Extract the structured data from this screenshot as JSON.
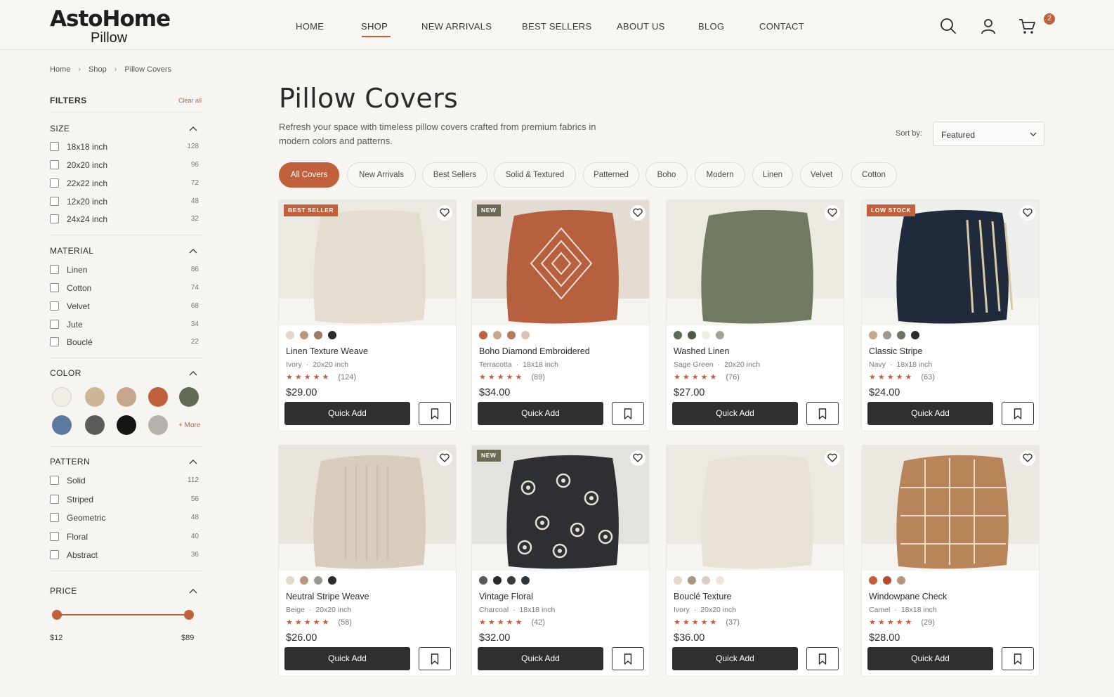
{
  "brand": {
    "name": "AstoHome",
    "sub": "Pillow"
  },
  "nav": [
    "HOME",
    "SHOP",
    "NEW ARRIVALS",
    "BEST SELLERS",
    "ABOUT US",
    "BLOG",
    "CONTACT"
  ],
  "cart": {
    "count": "2"
  },
  "breadcrumb": [
    "Home",
    "Shop",
    "Pillow Covers"
  ],
  "filters": {
    "title": "FILTERS",
    "clear": "Clear all",
    "size": {
      "title": "SIZE",
      "options": [
        {
          "label": "18x18 inch",
          "count": "128"
        },
        {
          "label": "20x20 inch",
          "count": "96"
        },
        {
          "label": "22x22 inch",
          "count": "72"
        },
        {
          "label": "12x20 inch",
          "count": "48"
        },
        {
          "label": "24x24 inch",
          "count": "32"
        }
      ]
    },
    "material": {
      "title": "MATERIAL",
      "options": [
        {
          "label": "Linen",
          "count": "86"
        },
        {
          "label": "Cotton",
          "count": "74"
        },
        {
          "label": "Velvet",
          "count": "68"
        },
        {
          "label": "Jute",
          "count": "34"
        },
        {
          "label": "Bouclé",
          "count": "22"
        }
      ]
    },
    "color": {
      "title": "COLOR",
      "swatches": [
        "#f1eee8",
        "#cdb597",
        "#c8a68e",
        "#c0603d",
        "#5f6b55",
        "#5b7a9e",
        "#5b5b5b",
        "#161616",
        "#b6b1ab"
      ],
      "more": "+ More"
    },
    "pattern": {
      "title": "PATTERN",
      "options": [
        {
          "label": "Solid",
          "count": "112"
        },
        {
          "label": "Striped",
          "count": "56"
        },
        {
          "label": "Geometric",
          "count": "48"
        },
        {
          "label": "Floral",
          "count": "40"
        },
        {
          "label": "Abstract",
          "count": "36"
        }
      ]
    },
    "price": {
      "title": "PRICE",
      "min": "$12",
      "max": "$89"
    }
  },
  "page": {
    "title": "Pillow Covers",
    "description": "Refresh your space with timeless pillow covers crafted from premium fabrics in modern colors and patterns.",
    "sort_label": "Sort by:",
    "sort_value": "Featured"
  },
  "categories": [
    "All Covers",
    "New Arrivals",
    "Best Sellers",
    "Solid & Textured",
    "Patterned",
    "Boho",
    "Modern",
    "Linen",
    "Velvet",
    "Cotton"
  ],
  "products": [
    {
      "name": "Linen Texture Weave",
      "color": "Ivory",
      "size": "20x20 inch",
      "reviews": "(124)",
      "price": "$29.00",
      "tag": "BEST SELLER",
      "tag_color": "#c0603d",
      "pillow": "#e5ddd0",
      "bg": "#ece8e2",
      "pattern": "none",
      "dots": [
        "#e3d8c8",
        "#b89680",
        "#9a7a62",
        "#2b2b2b"
      ]
    },
    {
      "name": "Boho Diamond Embroidered",
      "color": "Terracotta",
      "size": "18x18 inch",
      "reviews": "(89)",
      "price": "$34.00",
      "tag": "NEW",
      "tag_color": "#6b6a52",
      "pillow": "#b7603f",
      "bg": "#e4dcd2",
      "pattern": "diamond",
      "dots": [
        "#c0603d",
        "#c8a68e",
        "#b47a5c",
        "#d9c3b4"
      ]
    },
    {
      "name": "Washed Linen",
      "color": "Sage Green",
      "size": "20x20 inch",
      "reviews": "(76)",
      "price": "$27.00",
      "tag": "",
      "tag_color": "",
      "pillow": "#6f7a60",
      "bg": "#ece9e3",
      "pattern": "none",
      "dots": [
        "#5f6b55",
        "#4c5a45",
        "#efece6",
        "#a3a39b"
      ]
    },
    {
      "name": "Classic Stripe",
      "color": "Navy",
      "size": "18x18 inch",
      "reviews": "(63)",
      "price": "$24.00",
      "tag": "LOW STOCK",
      "tag_color": "#c0603d",
      "pillow": "#1f2a3a",
      "bg": "#efefed",
      "pattern": "stripes",
      "dots": [
        "#c8a68e",
        "#9a9a93",
        "#6d7266",
        "#2b2b2b"
      ]
    },
    {
      "name": "Neutral Stripe Weave",
      "color": "Beige",
      "size": "20x20 inch",
      "reviews": "(58)",
      "price": "$26.00",
      "tag": "",
      "tag_color": "",
      "pillow": "#d8cdbd",
      "bg": "#e9e5de",
      "pattern": "fine",
      "dots": [
        "#e3d8c8",
        "#b89680",
        "#9a9a93",
        "#2b2b2b"
      ]
    },
    {
      "name": "Vintage Floral",
      "color": "Charcoal",
      "size": "18x18 inch",
      "reviews": "(42)",
      "price": "$32.00",
      "tag": "NEW",
      "tag_color": "#6b6a52",
      "pillow": "#2e2f33",
      "bg": "#e4e2de",
      "pattern": "floral",
      "dots": [
        "#5b5b5b",
        "#2b2b2b",
        "#3a3a3a",
        "#2f3540"
      ]
    },
    {
      "name": "Bouclé Texture",
      "color": "Ivory",
      "size": "20x20 inch",
      "reviews": "(37)",
      "price": "$36.00",
      "tag": "",
      "tag_color": "",
      "pillow": "#e8e1d6",
      "bg": "#ece8e2",
      "pattern": "none",
      "dots": [
        "#e3d8c8",
        "#a8987e",
        "#d7cfc3",
        "#ebe5dc"
      ]
    },
    {
      "name": "Windowpane Check",
      "color": "Camel",
      "size": "18x18 inch",
      "reviews": "(29)",
      "price": "$28.00",
      "tag": "",
      "tag_color": "",
      "pillow": "#b8845a",
      "bg": "#ebe7e1",
      "pattern": "check",
      "dots": [
        "#c0603d",
        "#b44a30",
        "#b89680"
      ]
    }
  ],
  "card_labels": {
    "quick_add": "Quick Add",
    "stars": "★★★★★"
  }
}
